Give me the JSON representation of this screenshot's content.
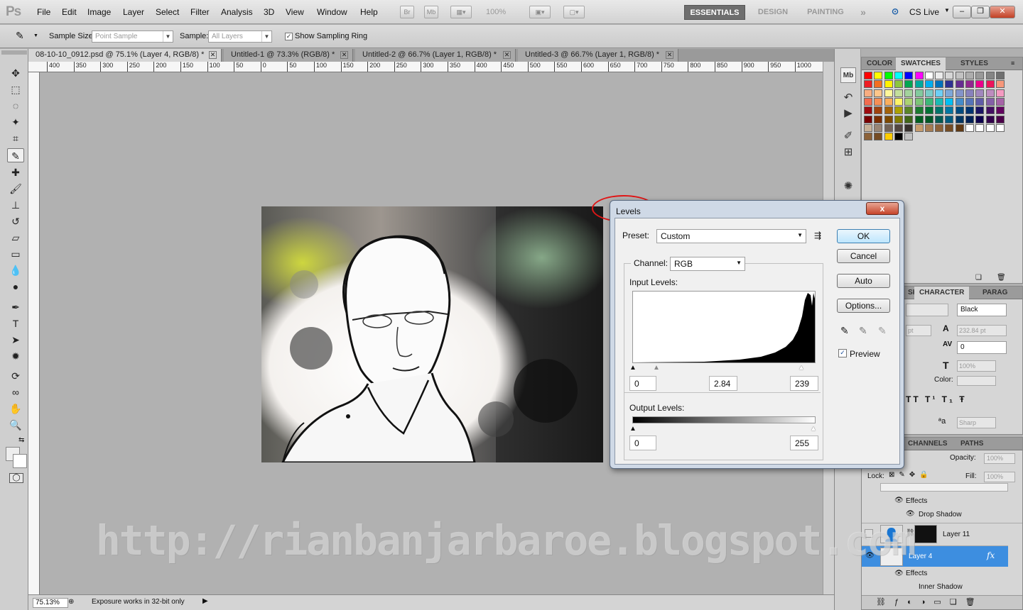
{
  "menubar": {
    "logo": "Ps",
    "items": [
      "File",
      "Edit",
      "Image",
      "Layer",
      "Select",
      "Filter",
      "Analysis",
      "3D",
      "View",
      "Window",
      "Help"
    ],
    "bridge": "Br",
    "minibridge": "Mb",
    "zoom": "100%",
    "workspaces": [
      "ESSENTIALS",
      "DESIGN",
      "PAINTING"
    ],
    "more": "»",
    "cslive": "CS Live"
  },
  "options": {
    "sample_size_label": "Sample Size:",
    "sample_size_value": "Point Sample",
    "sample_label": "Sample:",
    "sample_value": "All Layers",
    "sampling_ring_label": "Show Sampling Ring",
    "sampling_ring_checked": true
  },
  "tabs": [
    {
      "label": "08-10-10_0912.psd @ 75.1% (Layer 4, RGB/8) *"
    },
    {
      "label": "Untitled-1 @ 73.3% (RGB/8) *"
    },
    {
      "label": "Untitled-2 @ 66.7% (Layer 1, RGB/8) *"
    },
    {
      "label": "Untitled-3 @ 66.7% (Layer 1, RGB/8) *"
    }
  ],
  "ruler": {
    "ticks": [
      "400",
      "350",
      "300",
      "250",
      "200",
      "150",
      "100",
      "50",
      "0",
      "50",
      "100",
      "150",
      "200",
      "250",
      "300",
      "350",
      "400",
      "450",
      "500",
      "550",
      "600",
      "650",
      "700",
      "750",
      "800",
      "850",
      "900",
      "950",
      "1000"
    ]
  },
  "status": {
    "zoom": "75.13%",
    "message": "Exposure works in 32-bit only"
  },
  "swatches_panel": {
    "tabs": [
      "COLOR",
      "SWATCHES",
      "STYLES"
    ],
    "colors": [
      [
        "#ff0000",
        "#ffff00",
        "#00ff00",
        "#00ffff",
        "#0000ff",
        "#ff00ff",
        "#ffffff",
        "#ebebeb",
        "#d6d6d6",
        "#c2c2c2",
        "#adadad",
        "#999999",
        "#858585",
        "#707070"
      ],
      [
        "#ee1d24",
        "#f36f21",
        "#fff200",
        "#8dc63f",
        "#00a651",
        "#00a99d",
        "#00aeef",
        "#0072bc",
        "#2e3192",
        "#662d91",
        "#92278f",
        "#ec008c",
        "#ed145b",
        "#f7977a"
      ],
      [
        "#f9ad81",
        "#fdc68a",
        "#fff79a",
        "#c4df9b",
        "#a3d39c",
        "#82ca9d",
        "#7accc8",
        "#6dcff6",
        "#7da7d9",
        "#8393ca",
        "#8781bd",
        "#a187be",
        "#bd8cbf",
        "#f49ac1"
      ],
      [
        "#f26c4f",
        "#f68e55",
        "#fbaf5d",
        "#fff467",
        "#acd372",
        "#7cc576",
        "#3bb878",
        "#1abbb4",
        "#00bff3",
        "#438ccb",
        "#5574b9",
        "#605ca8",
        "#855fa8",
        "#a763a8"
      ],
      [
        "#9e0b0f",
        "#a0410d",
        "#a3620a",
        "#aba000",
        "#598527",
        "#1a7b30",
        "#007236",
        "#00746b",
        "#0076a3",
        "#004b80",
        "#003471",
        "#1b1464",
        "#440e62",
        "#630460"
      ],
      [
        "#790000",
        "#7b2e00",
        "#7d4900",
        "#827b00",
        "#406618",
        "#005e20",
        "#005826",
        "#005952",
        "#005b7f",
        "#003663",
        "#002157",
        "#0d004c",
        "#32004b",
        "#4b0049"
      ],
      [
        "#c7b299",
        "#998675",
        "#736357",
        "#534741",
        "#37302d",
        "#c69c6d",
        "#a67c52",
        "#8c6239",
        "#754c24",
        "#603913",
        "#ffffff",
        "#ffffff",
        "#ffffff",
        "#ffffff"
      ],
      [
        "#8c6239",
        "#754c24",
        "#ffcc00",
        "#000000",
        "#c0c0c0"
      ]
    ]
  },
  "character_panel": {
    "tabs": [
      "SK",
      "CHARACTER",
      "PARAG"
    ],
    "color_style": "Black",
    "size": "232.84 pt",
    "tracking": "0",
    "scale": "100%",
    "color_label": "Color:",
    "antialias": "Sharp",
    "pt_unit": "pt"
  },
  "layers_panel": {
    "tabs": [
      "CHANNELS",
      "PATHS"
    ],
    "opacity_label": "Opacity:",
    "opacity": "100%",
    "lock_label": "Lock:",
    "fill_label": "Fill:",
    "fill": "100%",
    "rows": [
      {
        "name": "Effects"
      },
      {
        "name": "Drop Shadow"
      },
      {
        "name": "Layer 11"
      },
      {
        "name": "Layer 4"
      },
      {
        "name": "Effects"
      },
      {
        "name": "Inner Shadow"
      }
    ],
    "fx": "fx"
  },
  "dialog": {
    "title": "Levels",
    "close": "x",
    "preset_label": "Preset:",
    "preset_value": "Custom",
    "channel_label": "Channel:",
    "channel_value": "RGB",
    "input_levels_label": "Input Levels:",
    "input_black": "0",
    "input_gamma": "2.84",
    "input_white": "239",
    "output_levels_label": "Output Levels:",
    "output_black": "0",
    "output_white": "255",
    "buttons": {
      "ok": "OK",
      "cancel": "Cancel",
      "auto": "Auto",
      "options": "Options..."
    },
    "preview_label": "Preview",
    "preview_checked": true
  },
  "watermark": "http://rianbanjarbaroe.blogspot.com"
}
